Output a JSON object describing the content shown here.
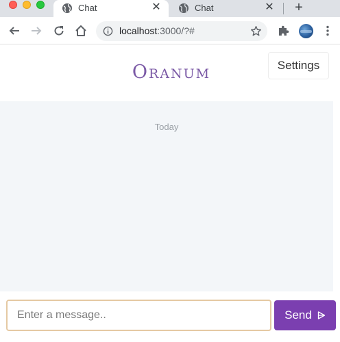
{
  "browser": {
    "tabs": [
      {
        "title": "Chat",
        "active": true,
        "icon": "globe-icon"
      },
      {
        "title": "Chat",
        "active": false,
        "icon": "globe-icon"
      }
    ],
    "url_host": "localhost",
    "url_rest": ":3000/?#"
  },
  "app": {
    "logo_text": "Oranum",
    "settings_label": "Settings",
    "day_separator": "Today",
    "message_placeholder": "Enter a message..",
    "send_label": "Send"
  },
  "colors": {
    "brand": "#7b5aa6",
    "send_button": "#7b3fb0",
    "input_border": "#e5c9a3",
    "chat_background": "#f3f6f9"
  }
}
